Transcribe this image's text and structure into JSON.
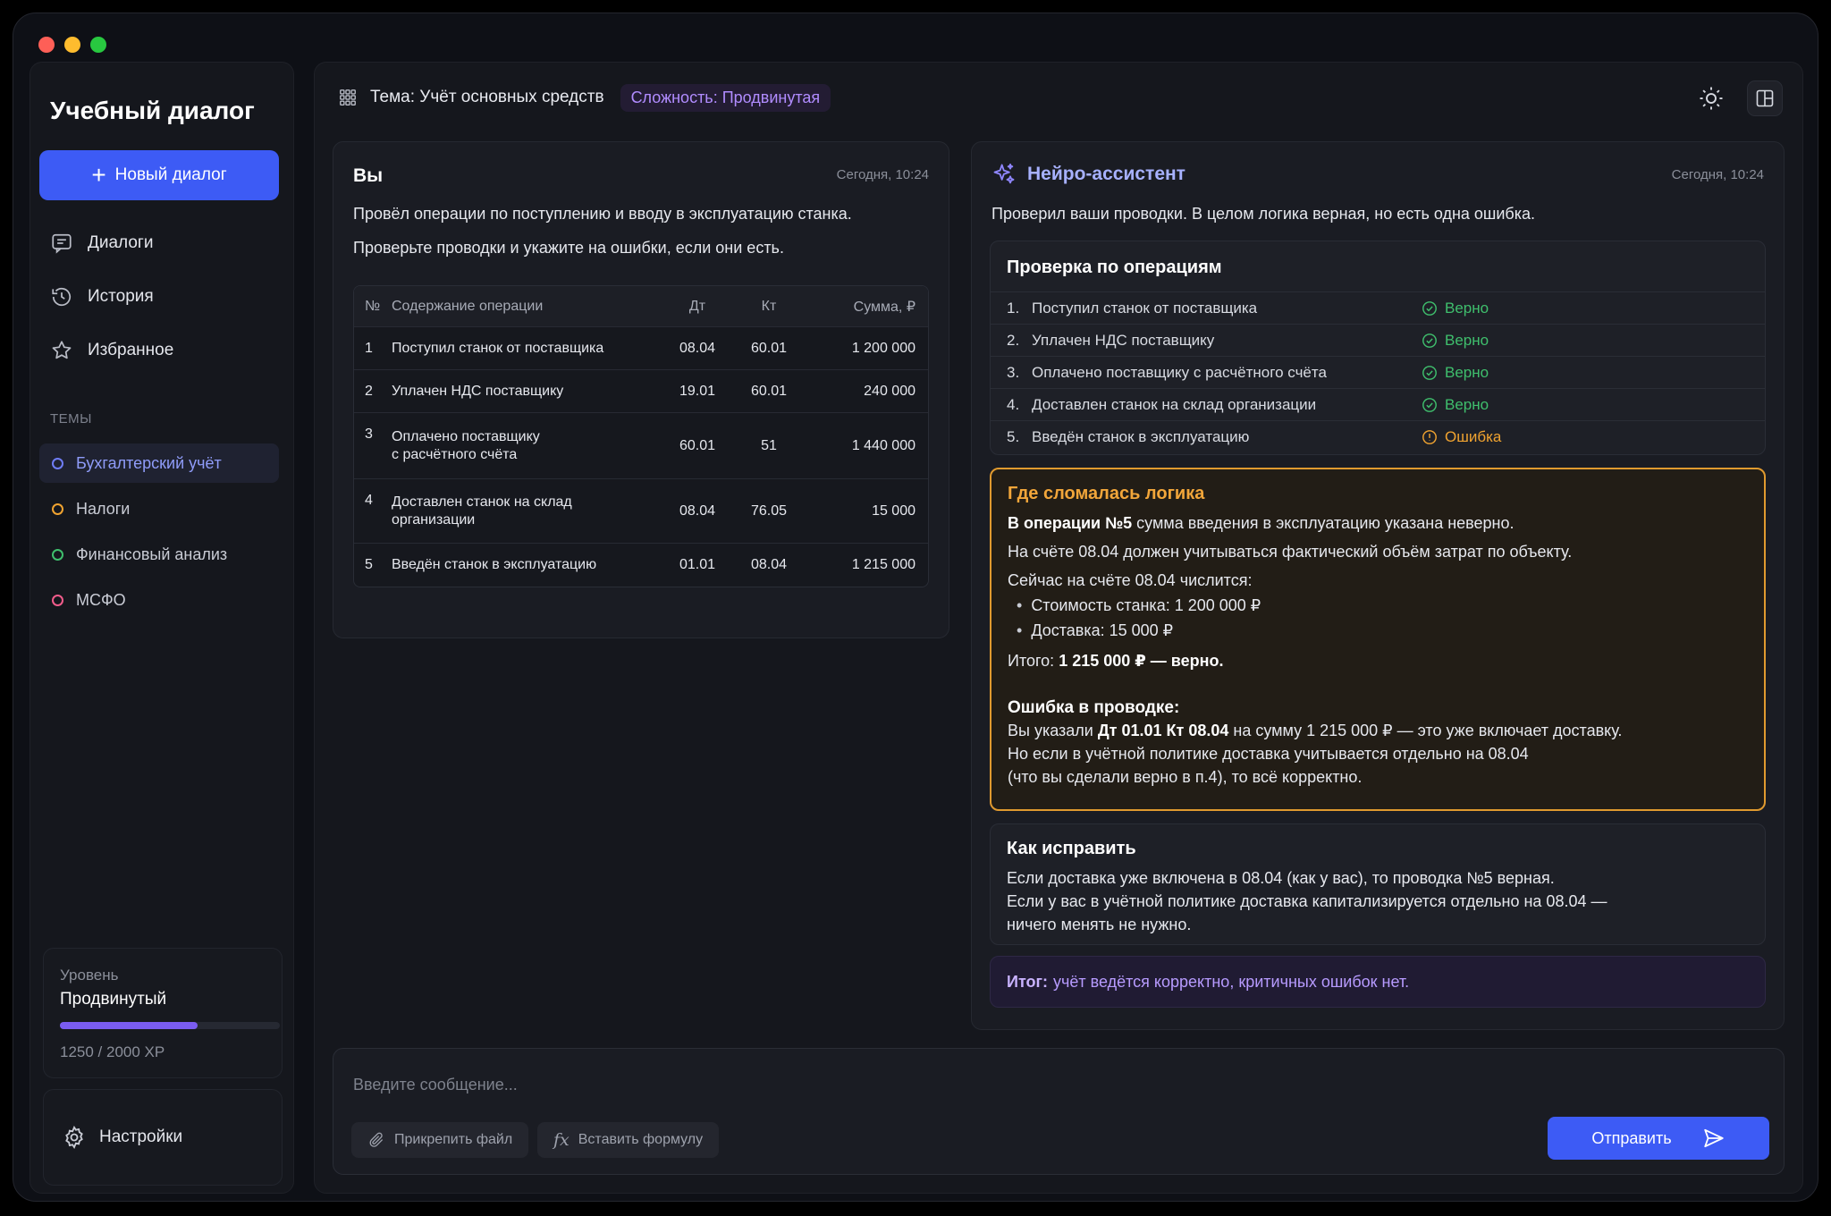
{
  "colors": {
    "accent": "#3d5bf5",
    "purple": "#b18cff",
    "success": "#3fbf6d",
    "warning": "#f0a330",
    "window_close": "#fe5f57",
    "window_minimize": "#febc2e",
    "window_zoom": "#28c840"
  },
  "sidebar": {
    "title": "Учебный диалог",
    "new_button": "Новый диалог",
    "nav": [
      {
        "label": "Диалоги",
        "icon": "chat-icon"
      },
      {
        "label": "История",
        "icon": "history-icon"
      },
      {
        "label": "Избранное",
        "icon": "star-icon"
      }
    ],
    "themes_label": "ТЕМЫ",
    "themes": [
      {
        "label": "Бухгалтерский учёт",
        "color": "#6f7df7",
        "active": true
      },
      {
        "label": "Налоги",
        "color": "#f0a330",
        "active": false
      },
      {
        "label": "Финансовый анализ",
        "color": "#3fbf6d",
        "active": false
      },
      {
        "label": "МСФО",
        "color": "#f25c8b",
        "active": false
      }
    ],
    "level": {
      "label": "Уровень",
      "value": "Продвинутый",
      "xp_text": "1250 / 2000 XP",
      "xp_current": 1250,
      "xp_max": 2000
    },
    "settings_label": "Настройки"
  },
  "header": {
    "topic": "Тема: Учёт основных средств",
    "difficulty": "Сложность: Продвинутая"
  },
  "user_message": {
    "author": "Вы",
    "time": "Сегодня, 10:24",
    "line1": "Провёл операции по поступлению и вводу в эксплуатацию станка.",
    "line2": "Проверьте проводки и укажите на ошибки, если они есть.",
    "table": {
      "headers": [
        "№",
        "Содержание операции",
        "Дт",
        "Кт",
        "Сумма, ₽"
      ],
      "rows": [
        {
          "no": "1",
          "text": [
            "Поступил станок от поставщика"
          ],
          "dt": "08.04",
          "kt": "60.01",
          "sum": "1 200 000"
        },
        {
          "no": "2",
          "text": [
            "Уплачен НДС поставщику"
          ],
          "dt": "19.01",
          "kt": "60.01",
          "sum": "240 000"
        },
        {
          "no": "3",
          "text": [
            "Оплачено поставщику",
            "с расчётного счёта"
          ],
          "dt": "60.01",
          "kt": "51",
          "sum": "1 440 000"
        },
        {
          "no": "4",
          "text": [
            "Доставлен станок на склад",
            "организации"
          ],
          "dt": "08.04",
          "kt": "76.05",
          "sum": "15 000"
        },
        {
          "no": "5",
          "text": [
            "Введён станок в эксплуатацию"
          ],
          "dt": "01.01",
          "kt": "08.04",
          "sum": "1 215 000"
        }
      ]
    }
  },
  "assistant": {
    "name": "Нейро-ассистент",
    "time": "Сегодня, 10:24",
    "intro": "Проверил ваши проводки. В целом логика верная, но есть одна ошибка.",
    "check": {
      "title": "Проверка по операциям",
      "rows": [
        {
          "no": "1.",
          "text": "Поступил станок от поставщика",
          "status": "Верно",
          "ok": true
        },
        {
          "no": "2.",
          "text": "Уплачен НДС поставщику",
          "status": "Верно",
          "ok": true
        },
        {
          "no": "3.",
          "text": "Оплачено поставщику с расчётного счёта",
          "status": "Верно",
          "ok": true
        },
        {
          "no": "4.",
          "text": "Доставлен станок на склад организации",
          "status": "Верно",
          "ok": true
        },
        {
          "no": "5.",
          "text": "Введён станок в эксплуатацию",
          "status": "Ошибка",
          "ok": false
        }
      ]
    },
    "broke": {
      "title": "Где сломалась логика",
      "l1_bold": "В операции №5",
      "l1_rest": " сумма введения в эксплуатацию указана неверно.",
      "l2": "На счёте 08.04 должен учитываться фактический объём затрат по объекту.",
      "l3": "Сейчас на счёте 08.04 числится:",
      "b1": "Стоимость станка: 1 200 000 ₽",
      "b2": "Доставка: 15 000 ₽",
      "total_prefix": "Итого: ",
      "total_bold": "1 215 000 ₽ — верно.",
      "err_title": "Ошибка в проводке:",
      "e1_prefix": "Вы указали ",
      "e1_bold": "Дт 01.01 Кт 08.04",
      "e1_rest": " на сумму 1 215 000 ₽ — это уже включает доставку.",
      "e2": "Но если в учётной политике доставка учитывается отдельно на 08.04",
      "e3": "(что вы сделали верно в п.4), то всё корректно."
    },
    "fix": {
      "title": "Как исправить",
      "l1": "Если доставка уже включена в 08.04 (как у вас), то проводка №5 верная.",
      "l2": "Если у вас в учётной политике доставка капитализируется отдельно на 08.04 —",
      "l3": "ничего менять не нужно."
    },
    "result": {
      "bold": "Итог:",
      "text": "учёт ведётся корректно, критичных ошибок нет."
    }
  },
  "composer": {
    "placeholder": "Введите сообщение...",
    "attach": "Прикрепить файл",
    "formula": "Вставить формулу",
    "send": "Отправить"
  }
}
